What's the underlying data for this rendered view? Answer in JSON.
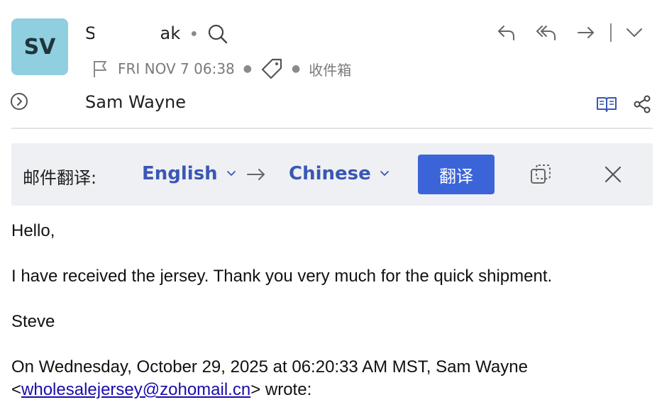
{
  "sender": {
    "initials": "SV",
    "name_start": "S",
    "name_end": "ak"
  },
  "meta": {
    "date": "FRI NOV 7 06:38",
    "folder": "收件箱"
  },
  "recipient": {
    "name": "Sam Wayne"
  },
  "translate": {
    "label": "邮件翻译:",
    "from_lang": "English",
    "to_lang": "Chinese",
    "button": "翻译"
  },
  "body": {
    "greeting": "Hello,",
    "line1": "I have received the jersey. Thank you very much for the quick shipment.",
    "signature": "Steve",
    "quote_line1": "On Wednesday, October 29, 2025 at 06:20:33 AM MST, Sam Wayne",
    "quote_open": "<",
    "quote_email": "wholesalejersey@zohomail.cn",
    "quote_close": "> wrote:"
  },
  "icons": [
    "search-icon",
    "flag-icon",
    "tag-icon",
    "reply-icon",
    "reply-all-icon",
    "forward-icon",
    "chevron-down-icon",
    "expand-icon",
    "reading-mode-icon",
    "share-icon",
    "arrow-right-icon",
    "copy-icon",
    "close-icon"
  ],
  "colors": {
    "avatar_bg": "#8fcfdf",
    "accent": "#3a57b4",
    "button_bg": "#3a64d8",
    "link": "#1a0dab",
    "bar_bg": "#eff0f3"
  }
}
